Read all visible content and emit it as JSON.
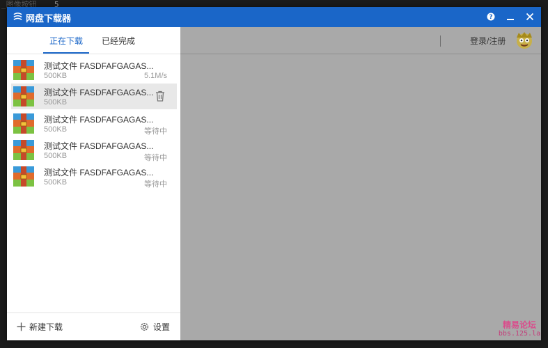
{
  "window": {
    "title": "网盘下载器",
    "help_glyph": "?",
    "minimize_glyph": "—",
    "close_glyph": "✕"
  },
  "topbar": {
    "login_label": "登录/注册"
  },
  "tabs": {
    "downloading": "正在下载",
    "completed": "已经完成"
  },
  "downloads": [
    {
      "name": "测试文件 FASDFAFGAGAS...",
      "size": "500KB",
      "status": "5.1M/s"
    },
    {
      "name": "测试文件 FASDFAFGAGAS...",
      "size": "500KB",
      "status": ""
    },
    {
      "name": "测试文件 FASDFAFGAGAS...",
      "size": "500KB",
      "status": "等待中"
    },
    {
      "name": "测试文件 FASDFAFGAGAS...",
      "size": "500KB",
      "status": "等待中"
    },
    {
      "name": "测试文件 FASDFAFGAGAS...",
      "size": "500KB",
      "status": "等待中"
    }
  ],
  "bottom": {
    "new_download": "新建下载",
    "settings": "设置"
  },
  "background": {
    "top_text": "_图像按钮",
    "line_number": "5"
  },
  "watermark": {
    "line1": "精易论坛",
    "line2": "bbs.125.la"
  },
  "colors": {
    "accent": "#1a66c8",
    "titlebar": "#1a66c8",
    "overlay": "#a9a9a9",
    "watermark": "#d94d8c"
  }
}
